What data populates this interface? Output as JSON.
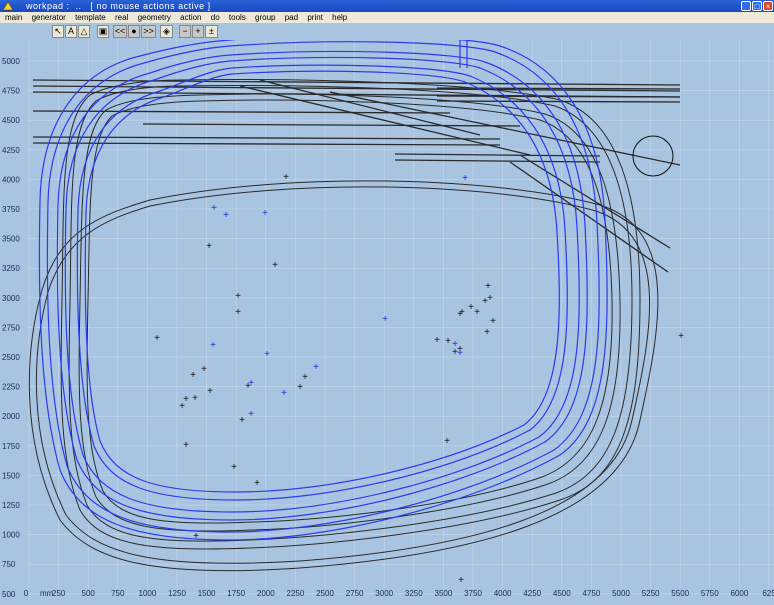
{
  "window": {
    "title": "workpad :  ..   [ no mouse actions active ]",
    "buttons": [
      "minimize",
      "maximize",
      "close"
    ]
  },
  "menu": [
    "main",
    "generator",
    "template",
    "real",
    "geometry",
    "action",
    "do",
    "tools",
    "group",
    "pad",
    "print",
    "help"
  ],
  "toolbar": {
    "status_count": "0",
    "buttons": [
      {
        "name": "pointer-tool",
        "label": "↖"
      },
      {
        "name": "text-tool",
        "label": "A"
      },
      {
        "name": "shape-tool",
        "label": "△"
      },
      {
        "name": "frame-tool",
        "label": "▣"
      },
      {
        "name": "prev-button",
        "label": "<<"
      },
      {
        "name": "centre-button",
        "label": "●"
      },
      {
        "name": "next-button",
        "label": ">>"
      },
      {
        "name": "fit-button",
        "label": "◈"
      },
      {
        "name": "zoom-out-button",
        "label": "−"
      },
      {
        "name": "zoom-in-button",
        "label": "+"
      },
      {
        "name": "zoom-fit-button",
        "label": "±"
      }
    ]
  },
  "canvas": {
    "x_axis": {
      "unit": "mm",
      "labels": [
        "0",
        "250",
        "500",
        "750",
        "1000",
        "1250",
        "1500",
        "1750",
        "2000",
        "2250",
        "2500",
        "2750",
        "3000",
        "3250",
        "3500",
        "3750",
        "4000",
        "4250",
        "4500",
        "4750",
        "5000",
        "5250",
        "5500",
        "5750",
        "6000",
        "625"
      ]
    },
    "y_axis": {
      "labels": [
        "5000",
        "4750",
        "4500",
        "4250",
        "4000",
        "3750",
        "3500",
        "3250",
        "3000",
        "2750",
        "2500",
        "2250",
        "2000",
        "1750",
        "1500",
        "1250",
        "1000",
        "750",
        "500"
      ]
    },
    "colors": {
      "background": "#a8c4e0",
      "grid": "#c8d8ee",
      "track_blue": "#2b3bf0",
      "track_black": "#2a2a2a",
      "marker_blue": "#1a2ae0",
      "marker_black": "#101010"
    }
  }
}
